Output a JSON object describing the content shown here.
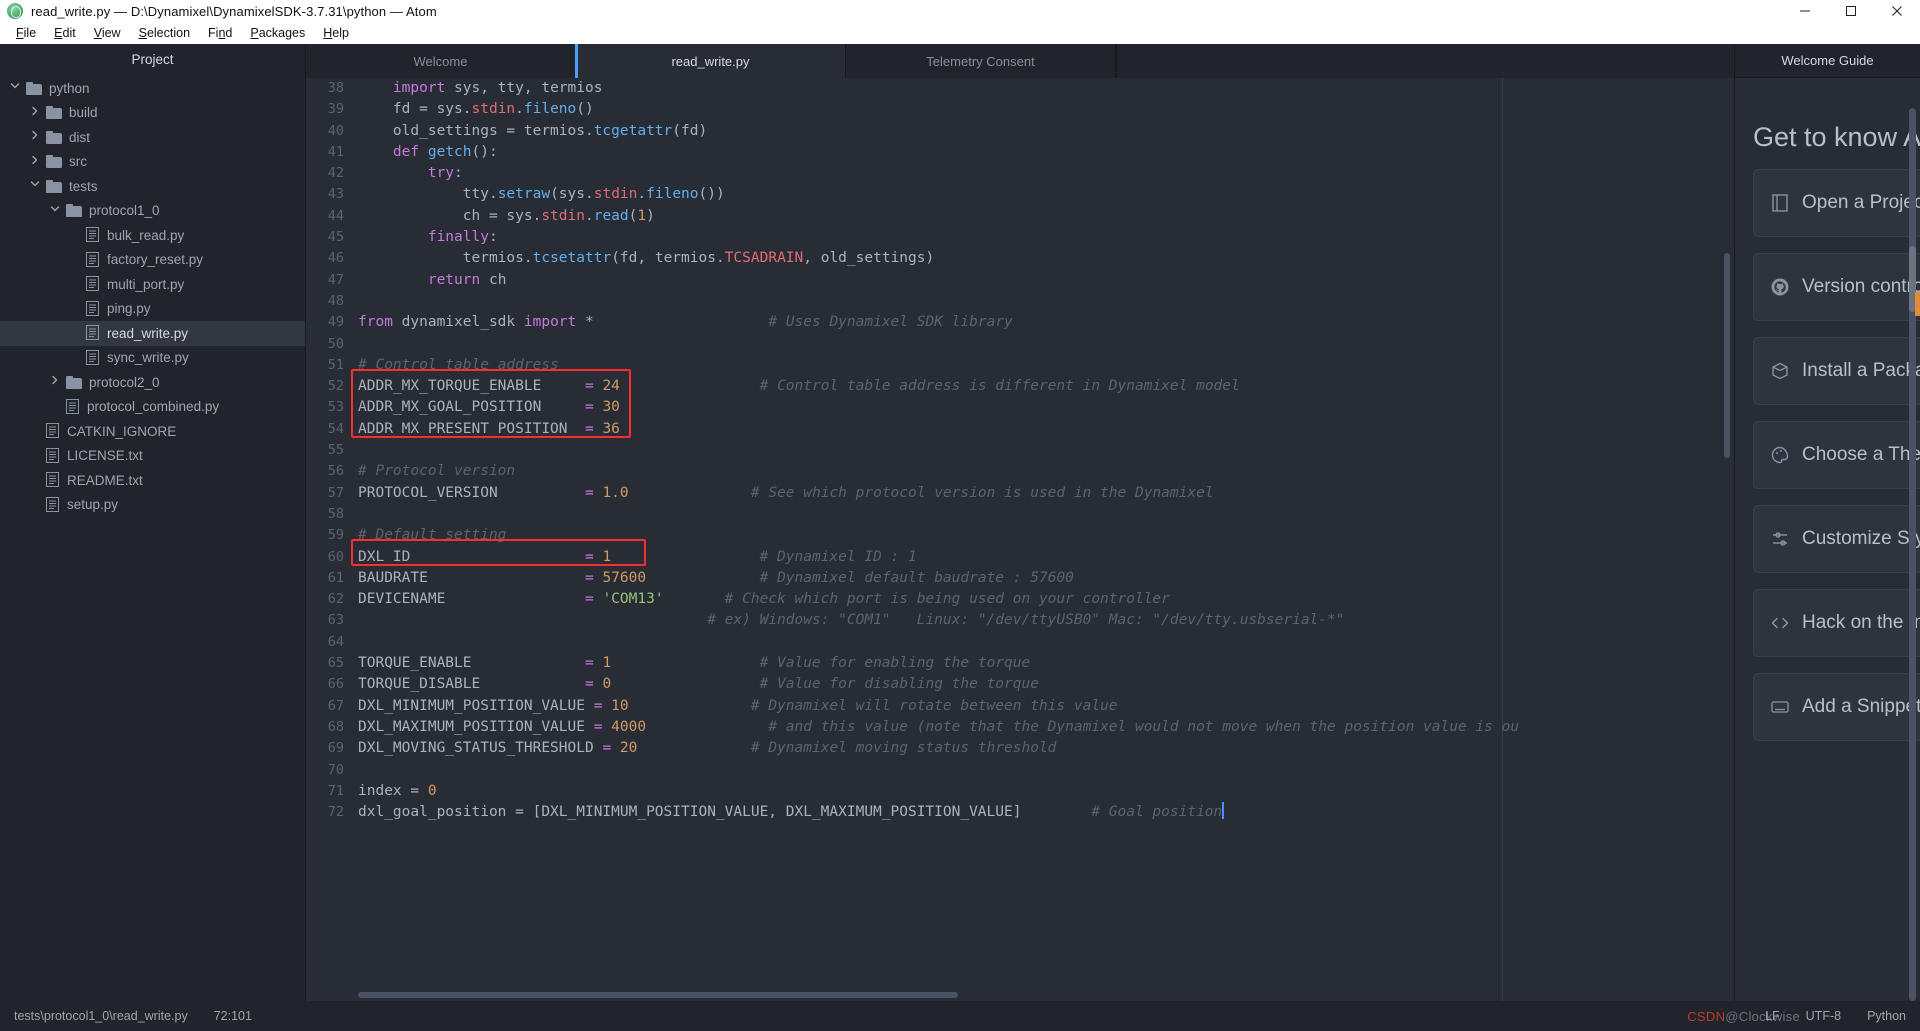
{
  "window": {
    "title": "read_write.py — D:\\Dynamixel\\DynamixelSDK-3.7.31\\python — Atom",
    "logo_icon": "atom-logo-icon",
    "minimize_label": "—",
    "maximize_label": "▢",
    "close_label": "✕"
  },
  "menubar": {
    "items": [
      {
        "label": "File",
        "accel": "F"
      },
      {
        "label": "Edit",
        "accel": "E"
      },
      {
        "label": "View",
        "accel": "V"
      },
      {
        "label": "Selection",
        "accel": "S"
      },
      {
        "label": "Find",
        "accel": "n"
      },
      {
        "label": "Packages",
        "accel": "P"
      },
      {
        "label": "Help",
        "accel": "H"
      }
    ]
  },
  "sidebar": {
    "header": "Project",
    "tree": [
      {
        "label": "python",
        "depth": 0,
        "type": "folder",
        "state": "open",
        "selected": false
      },
      {
        "label": "build",
        "depth": 1,
        "type": "folder",
        "state": "closed",
        "selected": false
      },
      {
        "label": "dist",
        "depth": 1,
        "type": "folder",
        "state": "closed",
        "selected": false
      },
      {
        "label": "src",
        "depth": 1,
        "type": "folder",
        "state": "closed",
        "selected": false
      },
      {
        "label": "tests",
        "depth": 1,
        "type": "folder",
        "state": "open",
        "selected": false
      },
      {
        "label": "protocol1_0",
        "depth": 2,
        "type": "folder",
        "state": "open",
        "selected": false
      },
      {
        "label": "bulk_read.py",
        "depth": 3,
        "type": "file",
        "state": "none",
        "selected": false
      },
      {
        "label": "factory_reset.py",
        "depth": 3,
        "type": "file",
        "state": "none",
        "selected": false
      },
      {
        "label": "multi_port.py",
        "depth": 3,
        "type": "file",
        "state": "none",
        "selected": false
      },
      {
        "label": "ping.py",
        "depth": 3,
        "type": "file",
        "state": "none",
        "selected": false
      },
      {
        "label": "read_write.py",
        "depth": 3,
        "type": "file",
        "state": "none",
        "selected": true
      },
      {
        "label": "sync_write.py",
        "depth": 3,
        "type": "file",
        "state": "none",
        "selected": false
      },
      {
        "label": "protocol2_0",
        "depth": 2,
        "type": "folder",
        "state": "closed",
        "selected": false
      },
      {
        "label": "protocol_combined.py",
        "depth": 2,
        "type": "file",
        "state": "none",
        "selected": false
      },
      {
        "label": "CATKIN_IGNORE",
        "depth": 1,
        "type": "file",
        "state": "none",
        "selected": false
      },
      {
        "label": "LICENSE.txt",
        "depth": 1,
        "type": "file",
        "state": "none",
        "selected": false
      },
      {
        "label": "README.txt",
        "depth": 1,
        "type": "file",
        "state": "none",
        "selected": false
      },
      {
        "label": "setup.py",
        "depth": 1,
        "type": "file",
        "state": "none",
        "selected": false
      }
    ]
  },
  "tabs": [
    {
      "label": "Welcome",
      "active": false
    },
    {
      "label": "read_write.py",
      "active": true
    },
    {
      "label": "Telemetry Consent",
      "active": false
    }
  ],
  "editor": {
    "first_line": 38,
    "highlight_color": "#ff2d2d",
    "cursor_color": "#528bff",
    "lines": [
      {
        "n": 38,
        "tokens": [
          {
            "t": "pln",
            "v": "    "
          },
          {
            "t": "kw",
            "v": "import"
          },
          {
            "t": "pln",
            "v": " sys, tty, termios"
          }
        ]
      },
      {
        "n": 39,
        "tokens": [
          {
            "t": "pln",
            "v": "    fd = sys."
          },
          {
            "t": "prop",
            "v": "stdin"
          },
          {
            "t": "pln",
            "v": "."
          },
          {
            "t": "fn",
            "v": "fileno"
          },
          {
            "t": "pln",
            "v": "()"
          }
        ]
      },
      {
        "n": 40,
        "tokens": [
          {
            "t": "pln",
            "v": "    old_settings = termios."
          },
          {
            "t": "fn",
            "v": "tcgetattr"
          },
          {
            "t": "pln",
            "v": "(fd)"
          }
        ]
      },
      {
        "n": 41,
        "tokens": [
          {
            "t": "pln",
            "v": "    "
          },
          {
            "t": "kw",
            "v": "def"
          },
          {
            "t": "pln",
            "v": " "
          },
          {
            "t": "fn",
            "v": "getch"
          },
          {
            "t": "pln",
            "v": "():"
          }
        ]
      },
      {
        "n": 42,
        "tokens": [
          {
            "t": "pln",
            "v": "        "
          },
          {
            "t": "kw",
            "v": "try"
          },
          {
            "t": "pln",
            "v": ":"
          }
        ]
      },
      {
        "n": 43,
        "tokens": [
          {
            "t": "pln",
            "v": "            tty."
          },
          {
            "t": "fn",
            "v": "setraw"
          },
          {
            "t": "pln",
            "v": "(sys."
          },
          {
            "t": "prop",
            "v": "stdin"
          },
          {
            "t": "pln",
            "v": "."
          },
          {
            "t": "fn",
            "v": "fileno"
          },
          {
            "t": "pln",
            "v": "())"
          }
        ]
      },
      {
        "n": 44,
        "tokens": [
          {
            "t": "pln",
            "v": "            ch = sys."
          },
          {
            "t": "prop",
            "v": "stdin"
          },
          {
            "t": "pln",
            "v": "."
          },
          {
            "t": "fn",
            "v": "read"
          },
          {
            "t": "pln",
            "v": "("
          },
          {
            "t": "num",
            "v": "1"
          },
          {
            "t": "pln",
            "v": ")"
          }
        ]
      },
      {
        "n": 45,
        "tokens": [
          {
            "t": "pln",
            "v": "        "
          },
          {
            "t": "kw",
            "v": "finally"
          },
          {
            "t": "pln",
            "v": ":"
          }
        ]
      },
      {
        "n": 46,
        "tokens": [
          {
            "t": "pln",
            "v": "            termios."
          },
          {
            "t": "fn",
            "v": "tcsetattr"
          },
          {
            "t": "pln",
            "v": "(fd, termios."
          },
          {
            "t": "prop",
            "v": "TCSADRAIN"
          },
          {
            "t": "pln",
            "v": ", old_settings)"
          }
        ]
      },
      {
        "n": 47,
        "tokens": [
          {
            "t": "pln",
            "v": "        "
          },
          {
            "t": "kw",
            "v": "return"
          },
          {
            "t": "pln",
            "v": " ch"
          }
        ]
      },
      {
        "n": 48,
        "tokens": []
      },
      {
        "n": 49,
        "tokens": [
          {
            "t": "kw",
            "v": "from"
          },
          {
            "t": "pln",
            "v": " dynamixel_sdk "
          },
          {
            "t": "kw",
            "v": "import"
          },
          {
            "t": "pln",
            "v": " *"
          },
          {
            "t": "pln",
            "v": "                    "
          },
          {
            "t": "cmt",
            "v": "# Uses Dynamixel SDK library"
          }
        ]
      },
      {
        "n": 50,
        "tokens": []
      },
      {
        "n": 51,
        "tokens": [
          {
            "t": "cmt",
            "v": "# Control table address"
          }
        ]
      },
      {
        "n": 52,
        "tokens": [
          {
            "t": "pln",
            "v": "ADDR_MX_TORQUE_ENABLE     "
          },
          {
            "t": "op",
            "v": "="
          },
          {
            "t": "pln",
            "v": " "
          },
          {
            "t": "num",
            "v": "24"
          },
          {
            "t": "pln",
            "v": "                "
          },
          {
            "t": "cmt",
            "v": "# Control table address is different in Dynamixel model"
          }
        ]
      },
      {
        "n": 53,
        "tokens": [
          {
            "t": "pln",
            "v": "ADDR_MX_GOAL_POSITION     "
          },
          {
            "t": "op",
            "v": "="
          },
          {
            "t": "pln",
            "v": " "
          },
          {
            "t": "num",
            "v": "30"
          }
        ]
      },
      {
        "n": 54,
        "tokens": [
          {
            "t": "pln",
            "v": "ADDR_MX_PRESENT_POSITION  "
          },
          {
            "t": "op",
            "v": "="
          },
          {
            "t": "pln",
            "v": " "
          },
          {
            "t": "num",
            "v": "36"
          }
        ]
      },
      {
        "n": 55,
        "tokens": []
      },
      {
        "n": 56,
        "tokens": [
          {
            "t": "cmt",
            "v": "# Protocol version"
          }
        ]
      },
      {
        "n": 57,
        "tokens": [
          {
            "t": "pln",
            "v": "PROTOCOL_VERSION          "
          },
          {
            "t": "op",
            "v": "="
          },
          {
            "t": "pln",
            "v": " "
          },
          {
            "t": "num",
            "v": "1.0"
          },
          {
            "t": "pln",
            "v": "              "
          },
          {
            "t": "cmt",
            "v": "# See which protocol version is used in the Dynamixel"
          }
        ]
      },
      {
        "n": 58,
        "tokens": []
      },
      {
        "n": 59,
        "tokens": [
          {
            "t": "cmt",
            "v": "# Default setting"
          }
        ]
      },
      {
        "n": 60,
        "tokens": [
          {
            "t": "pln",
            "v": "DXL_ID                    "
          },
          {
            "t": "op",
            "v": "="
          },
          {
            "t": "pln",
            "v": " "
          },
          {
            "t": "num",
            "v": "1"
          },
          {
            "t": "pln",
            "v": "                 "
          },
          {
            "t": "cmt",
            "v": "# Dynamixel ID : 1"
          }
        ]
      },
      {
        "n": 61,
        "tokens": [
          {
            "t": "pln",
            "v": "BAUDRATE                  "
          },
          {
            "t": "op",
            "v": "="
          },
          {
            "t": "pln",
            "v": " "
          },
          {
            "t": "num",
            "v": "57600"
          },
          {
            "t": "pln",
            "v": "             "
          },
          {
            "t": "cmt",
            "v": "# Dynamixel default baudrate : 57600"
          }
        ]
      },
      {
        "n": 62,
        "tokens": [
          {
            "t": "pln",
            "v": "DEVICENAME                "
          },
          {
            "t": "op",
            "v": "="
          },
          {
            "t": "pln",
            "v": " "
          },
          {
            "t": "str",
            "v": "'COM13'"
          },
          {
            "t": "pln",
            "v": "       "
          },
          {
            "t": "cmt",
            "v": "# Check which port is being used on your controller"
          }
        ]
      },
      {
        "n": 63,
        "tokens": [
          {
            "t": "pln",
            "v": "                                        "
          },
          {
            "t": "cmt",
            "v": "# ex) Windows: \"COM1\"   Linux: \"/dev/ttyUSB0\" Mac: \"/dev/tty.usbserial-*\""
          }
        ]
      },
      {
        "n": 64,
        "tokens": []
      },
      {
        "n": 65,
        "tokens": [
          {
            "t": "pln",
            "v": "TORQUE_ENABLE             "
          },
          {
            "t": "op",
            "v": "="
          },
          {
            "t": "pln",
            "v": " "
          },
          {
            "t": "num",
            "v": "1"
          },
          {
            "t": "pln",
            "v": "                 "
          },
          {
            "t": "cmt",
            "v": "# Value for enabling the torque"
          }
        ]
      },
      {
        "n": 66,
        "tokens": [
          {
            "t": "pln",
            "v": "TORQUE_DISABLE            "
          },
          {
            "t": "op",
            "v": "="
          },
          {
            "t": "pln",
            "v": " "
          },
          {
            "t": "num",
            "v": "0"
          },
          {
            "t": "pln",
            "v": "                 "
          },
          {
            "t": "cmt",
            "v": "# Value for disabling the torque"
          }
        ]
      },
      {
        "n": 67,
        "tokens": [
          {
            "t": "pln",
            "v": "DXL_MINIMUM_POSITION_VALUE "
          },
          {
            "t": "op",
            "v": "="
          },
          {
            "t": "pln",
            "v": " "
          },
          {
            "t": "num",
            "v": "10"
          },
          {
            "t": "pln",
            "v": "              "
          },
          {
            "t": "cmt",
            "v": "# Dynamixel will rotate between this value"
          }
        ]
      },
      {
        "n": 68,
        "tokens": [
          {
            "t": "pln",
            "v": "DXL_MAXIMUM_POSITION_VALUE "
          },
          {
            "t": "op",
            "v": "="
          },
          {
            "t": "pln",
            "v": " "
          },
          {
            "t": "num",
            "v": "4000"
          },
          {
            "t": "pln",
            "v": "              "
          },
          {
            "t": "cmt",
            "v": "# and this value (note that the Dynamixel would not move when the position value is ou"
          }
        ]
      },
      {
        "n": 69,
        "tokens": [
          {
            "t": "pln",
            "v": "DXL_MOVING_STATUS_THRESHOLD "
          },
          {
            "t": "op",
            "v": "="
          },
          {
            "t": "pln",
            "v": " "
          },
          {
            "t": "num",
            "v": "20"
          },
          {
            "t": "pln",
            "v": "             "
          },
          {
            "t": "cmt",
            "v": "# Dynamixel moving status threshold"
          }
        ]
      },
      {
        "n": 70,
        "tokens": []
      },
      {
        "n": 71,
        "tokens": [
          {
            "t": "pln",
            "v": "index = "
          },
          {
            "t": "num",
            "v": "0"
          }
        ]
      },
      {
        "n": 72,
        "tokens": [
          {
            "t": "pln",
            "v": "dxl_goal_position = [DXL_MINIMUM_POSITION_VALUE, DXL_MAXIMUM_POSITION_VALUE]"
          },
          {
            "t": "pln",
            "v": "        "
          },
          {
            "t": "cmt",
            "v": "# Goal position"
          }
        ],
        "cursor_at_end": true
      }
    ]
  },
  "welcome_guide": {
    "header": "Welcome Guide",
    "title": "Get to know Atom!",
    "cards": [
      {
        "icon": "book-icon",
        "label": "Open a Project"
      },
      {
        "icon": "github-icon",
        "label": "Version control with Git and GitHub"
      },
      {
        "icon": "package-icon",
        "label": "Install a Package"
      },
      {
        "icon": "palette-icon",
        "label": "Choose a Theme"
      },
      {
        "icon": "sliders-icon",
        "label": "Customize Styling"
      },
      {
        "icon": "code-icon",
        "label": "Hack on the Init Script"
      },
      {
        "icon": "keyboard-icon",
        "label": "Add a Snippet"
      }
    ]
  },
  "statusbar": {
    "file_path": "tests\\protocol1_0\\read_write.py",
    "cursor_position": "72:101",
    "line_ending": "LF",
    "encoding": "UTF-8",
    "grammar": "Python",
    "watermark_prefix": "CSDN",
    "watermark_suffix": "@Clockwise"
  }
}
